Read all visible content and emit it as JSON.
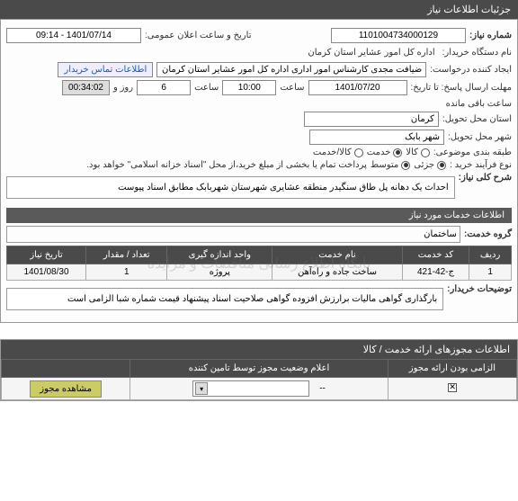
{
  "header": {
    "title": "جزئیات اطلاعات نیاز"
  },
  "form": {
    "req_no_label": "شماره نیاز:",
    "req_no": "1101004734000129",
    "pub_date_label": "تاریخ و ساعت اعلان عمومی:",
    "pub_date": "1401/07/14 - 09:14",
    "buyer_label": "نام دستگاه خریدار:",
    "buyer": "اداره کل امور عشایر استان کرمان",
    "creator_label": "ایجاد کننده درخواست:",
    "creator": "ضیافت مجدی کارشناس امور اداری اداره کل امور عشایر استان کرمان",
    "contact_link": "اطلاعات تماس خریدار",
    "deadline_label": "مهلت ارسال پاسخ: تا تاریخ:",
    "deadline_date": "1401/07/20",
    "time_label": "ساعت",
    "deadline_time": "10:00",
    "days": "6",
    "day_and": "روز و",
    "countdown": "00:34:02",
    "remaining": "ساعت باقی مانده",
    "province_label": "استان محل تحویل:",
    "province": "کرمان",
    "city_label": "شهر محل تحویل:",
    "city": "شهر بابک",
    "subject_type_label": "طبقه بندی موضوعی:",
    "radio_kala": "کالا",
    "radio_khadamat": "خدمت",
    "radio_both": "کالا/خدمت",
    "purchase_type_label": "نوع فرآیند خرید :",
    "radio_jozi": "جزئی",
    "radio_motavaset": "متوسط",
    "purchase_note": "پرداخت تمام یا بخشی از مبلغ خرید،از محل \"اسناد خزانه اسلامی\" خواهد بود.",
    "desc_label": "شرح کلی نیاز:",
    "desc_text": "احداث یک دهانه پل طاق سنگیدر منطقه عشایری شهرستان شهربابک مطابق اسناد پیوست",
    "services_header": "اطلاعات خدمات مورد نیاز",
    "groups_label": "گروه خدمت:",
    "groups_value": "ساختمان",
    "buyer_notes_label": "توضیحات خریدار:",
    "buyer_notes": "بارگذاری گواهی مالیات برارزش افزوده گواهی صلاحیت اسناد پیشنهاد قیمت شماره شبا الزامی است",
    "watermark": "پایگاه اطلاع رسانی مناقصات و مزایده"
  },
  "service_table": {
    "headers": [
      "ردیف",
      "کد خدمت",
      "نام خدمت",
      "واحد اندازه گیری",
      "تعداد / مقدار",
      "تاریخ نیاز"
    ],
    "row": {
      "idx": "1",
      "code": "ج-42-421",
      "name": "ساخت جاده و راه‌آهن",
      "unit": "پروژه",
      "qty": "1",
      "date": "1401/08/30"
    }
  },
  "bottom": {
    "header": "اطلاعات مجوزهای ارائه خدمت / کالا",
    "th_mandatory": "الزامی بودن ارائه مجوز",
    "th_status": "اعلام وضعیت مجوز توسط تامین کننده",
    "th_empty": "",
    "dash": "--",
    "view_btn": "مشاهده مجوز"
  }
}
